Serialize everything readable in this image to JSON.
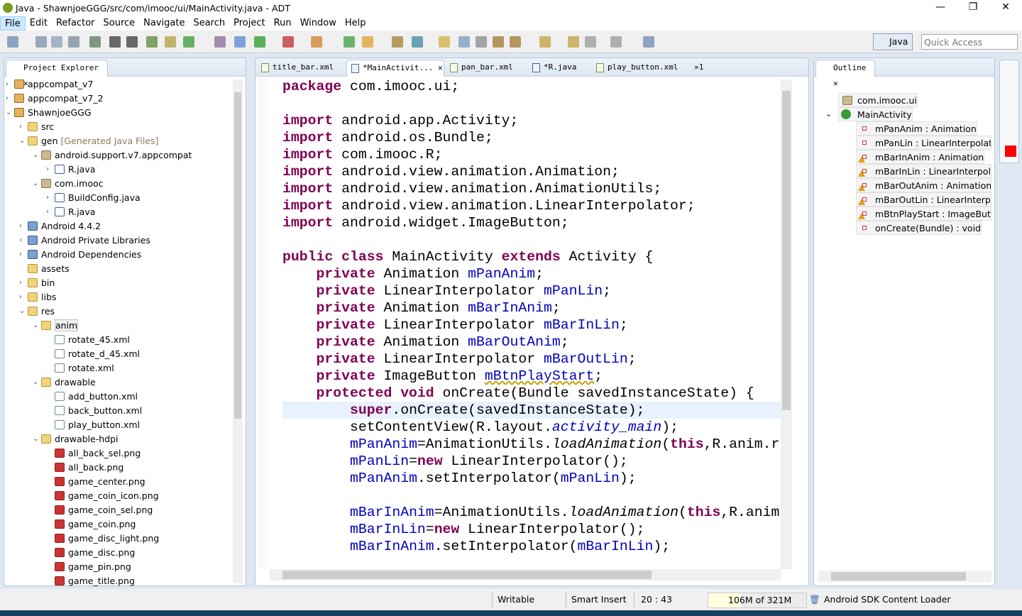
{
  "window": {
    "title": "Java - ShawnjoeGGG/src/com/imooc/ui/MainActivity.java - ADT",
    "minimize": "—",
    "restore": "❐",
    "close": "✕"
  },
  "menu": [
    "File",
    "Edit",
    "Refactor",
    "Source",
    "Navigate",
    "Search",
    "Project",
    "Run",
    "Window",
    "Help"
  ],
  "toolbar": {
    "perspective": "Java",
    "quick_access_placeholder": "Quick Access"
  },
  "explorer": {
    "title": "Project Explorer",
    "items": [
      {
        "label": "appcompat_v7",
        "depth": 0,
        "arrow": "›",
        "icon": "proj"
      },
      {
        "label": "appcompat_v7_2",
        "depth": 0,
        "arrow": "›",
        "icon": "proj"
      },
      {
        "label": "ShawnjoeGGG",
        "depth": 0,
        "arrow": "⌄",
        "icon": "proj"
      },
      {
        "label": "src",
        "depth": 1,
        "arrow": "›",
        "icon": "folder"
      },
      {
        "label": "gen",
        "suffix": " [Generated Java Files]",
        "depth": 1,
        "arrow": "⌄",
        "icon": "folder"
      },
      {
        "label": "android.support.v7.appcompat",
        "depth": 2,
        "arrow": "⌄",
        "icon": "pkg"
      },
      {
        "label": "R.java",
        "depth": 3,
        "arrow": "›",
        "icon": "java"
      },
      {
        "label": "com.imooc",
        "depth": 2,
        "arrow": "⌄",
        "icon": "pkg"
      },
      {
        "label": "BuildConfig.java",
        "depth": 3,
        "arrow": "›",
        "icon": "java"
      },
      {
        "label": "R.java",
        "depth": 3,
        "arrow": "›",
        "icon": "java"
      },
      {
        "label": "Android 4.4.2",
        "depth": 1,
        "arrow": "›",
        "icon": "lib"
      },
      {
        "label": "Android Private Libraries",
        "depth": 1,
        "arrow": "›",
        "icon": "lib"
      },
      {
        "label": "Android Dependencies",
        "depth": 1,
        "arrow": "›",
        "icon": "lib"
      },
      {
        "label": "assets",
        "depth": 1,
        "arrow": "",
        "icon": "folder"
      },
      {
        "label": "bin",
        "depth": 1,
        "arrow": "›",
        "icon": "folder"
      },
      {
        "label": "libs",
        "depth": 1,
        "arrow": "›",
        "icon": "folder"
      },
      {
        "label": "res",
        "depth": 1,
        "arrow": "⌄",
        "icon": "folder"
      },
      {
        "label": "anim",
        "depth": 2,
        "arrow": "⌄",
        "icon": "folder",
        "selected": true
      },
      {
        "label": "rotate_45.xml",
        "depth": 3,
        "arrow": "",
        "icon": "file"
      },
      {
        "label": "rotate_d_45.xml",
        "depth": 3,
        "arrow": "",
        "icon": "file"
      },
      {
        "label": "rotate.xml",
        "depth": 3,
        "arrow": "",
        "icon": "file"
      },
      {
        "label": "drawable",
        "depth": 2,
        "arrow": "⌄",
        "icon": "folder"
      },
      {
        "label": "add_button.xml",
        "depth": 3,
        "arrow": "",
        "icon": "file"
      },
      {
        "label": "back_button.xml",
        "depth": 3,
        "arrow": "",
        "icon": "file"
      },
      {
        "label": "play_button.xml",
        "depth": 3,
        "arrow": "",
        "icon": "file"
      },
      {
        "label": "drawable-hdpi",
        "depth": 2,
        "arrow": "⌄",
        "icon": "folder"
      },
      {
        "label": "all_back_sel.png",
        "depth": 3,
        "arrow": "",
        "icon": "png"
      },
      {
        "label": "all_back.png",
        "depth": 3,
        "arrow": "",
        "icon": "png"
      },
      {
        "label": "game_center.png",
        "depth": 3,
        "arrow": "",
        "icon": "png"
      },
      {
        "label": "game_coin_icon.png",
        "depth": 3,
        "arrow": "",
        "icon": "png"
      },
      {
        "label": "game_coin_sel.png",
        "depth": 3,
        "arrow": "",
        "icon": "png"
      },
      {
        "label": "game_coin.png",
        "depth": 3,
        "arrow": "",
        "icon": "png"
      },
      {
        "label": "game_disc_light.png",
        "depth": 3,
        "arrow": "",
        "icon": "png"
      },
      {
        "label": "game_disc.png",
        "depth": 3,
        "arrow": "",
        "icon": "png"
      },
      {
        "label": "game_pin.png",
        "depth": 3,
        "arrow": "",
        "icon": "png"
      },
      {
        "label": "game_title.png",
        "depth": 3,
        "arrow": "",
        "icon": "png"
      }
    ]
  },
  "editor": {
    "tabs": [
      {
        "label": "title_bar.xml",
        "type": "xml"
      },
      {
        "label": "*MainActivit...",
        "type": "java",
        "active": true
      },
      {
        "label": "pan_bar.xml",
        "type": "xml"
      },
      {
        "label": "*R.java",
        "type": "java"
      },
      {
        "label": "play_button.xml",
        "type": "xml"
      }
    ],
    "overflow": "»1",
    "lines": [
      [
        [
          "package",
          "kw"
        ],
        [
          " com.imooc.ui;",
          ""
        ]
      ],
      [],
      [
        [
          "import",
          "kw"
        ],
        [
          " android.app.Activity;",
          ""
        ]
      ],
      [
        [
          "import",
          "kw"
        ],
        [
          " android.os.Bundle;",
          ""
        ]
      ],
      [
        [
          "import",
          "kw"
        ],
        [
          " com.imooc.R;",
          ""
        ]
      ],
      [
        [
          "import",
          "kw"
        ],
        [
          " android.view.animation.Animation;",
          ""
        ]
      ],
      [
        [
          "import",
          "kw"
        ],
        [
          " android.view.animation.AnimationUtils;",
          ""
        ]
      ],
      [
        [
          "import",
          "kw"
        ],
        [
          " android.view.animation.LinearInterpolator;",
          ""
        ]
      ],
      [
        [
          "import",
          "kw"
        ],
        [
          " android.widget.ImageButton;",
          ""
        ]
      ],
      [],
      [
        [
          "public class",
          "kw"
        ],
        [
          " MainActivity ",
          ""
        ],
        [
          "extends",
          "kw"
        ],
        [
          " Activity {",
          ""
        ]
      ],
      [
        [
          "    ",
          ""
        ],
        [
          "private",
          "kw"
        ],
        [
          " Animation ",
          ""
        ],
        [
          "mPanAnim",
          "fld"
        ],
        [
          ";",
          ""
        ]
      ],
      [
        [
          "    ",
          ""
        ],
        [
          "private",
          "kw"
        ],
        [
          " LinearInterpolator ",
          ""
        ],
        [
          "mPanLin",
          "fld"
        ],
        [
          ";",
          ""
        ]
      ],
      [
        [
          "    ",
          ""
        ],
        [
          "private",
          "kw"
        ],
        [
          " Animation ",
          ""
        ],
        [
          "mBarInAnim",
          "fld"
        ],
        [
          ";",
          ""
        ]
      ],
      [
        [
          "    ",
          ""
        ],
        [
          "private",
          "kw"
        ],
        [
          " LinearInterpolator ",
          ""
        ],
        [
          "mBarInLin",
          "fld"
        ],
        [
          ";",
          ""
        ]
      ],
      [
        [
          "    ",
          ""
        ],
        [
          "private",
          "kw"
        ],
        [
          " Animation ",
          ""
        ],
        [
          "mBarOutAnim",
          "fld"
        ],
        [
          ";",
          ""
        ]
      ],
      [
        [
          "    ",
          ""
        ],
        [
          "private",
          "kw"
        ],
        [
          " LinearInterpolator ",
          ""
        ],
        [
          "mBarOutLin",
          "fld"
        ],
        [
          ";",
          ""
        ]
      ],
      [
        [
          "    ",
          ""
        ],
        [
          "private",
          "kw"
        ],
        [
          " ImageButton ",
          ""
        ],
        [
          "mBtnPlayStart",
          "fld warn"
        ],
        [
          ";",
          ""
        ]
      ],
      [
        [
          "    ",
          ""
        ],
        [
          "protected void",
          "kw"
        ],
        [
          " onCreate(Bundle savedInstanceState) {",
          ""
        ]
      ],
      [
        [
          "        ",
          ""
        ],
        [
          "super",
          "kw"
        ],
        [
          ".onCreate(savedInstanceState);",
          ""
        ]
      ],
      [
        [
          "        setContentView(R.layout.",
          ""
        ],
        [
          "activity_main",
          "sfld"
        ],
        [
          ");",
          ""
        ]
      ],
      [
        [
          "        ",
          ""
        ],
        [
          "mPanAnim",
          "fld"
        ],
        [
          "=AnimationUtils.",
          ""
        ],
        [
          "loadAnimation",
          "st"
        ],
        [
          "(",
          ""
        ],
        [
          "this",
          "kw"
        ],
        [
          ",R.anim.r",
          ""
        ]
      ],
      [
        [
          "        ",
          ""
        ],
        [
          "mPanLin",
          "fld"
        ],
        [
          "=",
          ""
        ],
        [
          "new",
          "kw"
        ],
        [
          " LinearInterpolator();",
          ""
        ]
      ],
      [
        [
          "        ",
          ""
        ],
        [
          "mPanAnim",
          "fld"
        ],
        [
          ".setInterpolator(",
          ""
        ],
        [
          "mPanLin",
          "fld"
        ],
        [
          ");",
          ""
        ]
      ],
      [],
      [
        [
          "        ",
          ""
        ],
        [
          "mBarInAnim",
          "fld"
        ],
        [
          "=AnimationUtils.",
          ""
        ],
        [
          "loadAnimation",
          "st"
        ],
        [
          "(",
          ""
        ],
        [
          "this",
          "kw"
        ],
        [
          ",R.anim",
          ""
        ]
      ],
      [
        [
          "        ",
          ""
        ],
        [
          "mBarInLin",
          "fld"
        ],
        [
          "=",
          ""
        ],
        [
          "new",
          "kw"
        ],
        [
          " LinearInterpolator();",
          ""
        ]
      ],
      [
        [
          "        ",
          ""
        ],
        [
          "mBarInAnim",
          "fld"
        ],
        [
          ".setInterpolator(",
          ""
        ],
        [
          "mBarInLin",
          "fld"
        ],
        [
          ");",
          ""
        ]
      ]
    ]
  },
  "outline": {
    "title": "Outline",
    "package": "com.imooc.ui",
    "class": "MainActivity",
    "members": [
      {
        "label": "mPanAnim : Animation",
        "warn": false
      },
      {
        "label": "mPanLin : LinearInterpolator",
        "warn": false
      },
      {
        "label": "mBarInAnim : Animation",
        "warn": true
      },
      {
        "label": "mBarInLin : LinearInterpolator",
        "warn": true
      },
      {
        "label": "mBarOutAnim : Animation",
        "warn": true
      },
      {
        "label": "mBarOutLin : LinearInterpolator",
        "warn": true
      },
      {
        "label": "mBtnPlayStart : ImageButton",
        "warn": true
      },
      {
        "label": "onCreate(Bundle) : void",
        "warn": false
      }
    ]
  },
  "status": {
    "mode": "Writable",
    "insert": "Smart Insert",
    "position": "20 : 43",
    "heap": "106M of 321M",
    "heap_used_fraction": 0.33,
    "task": "Android SDK Content Loader"
  }
}
